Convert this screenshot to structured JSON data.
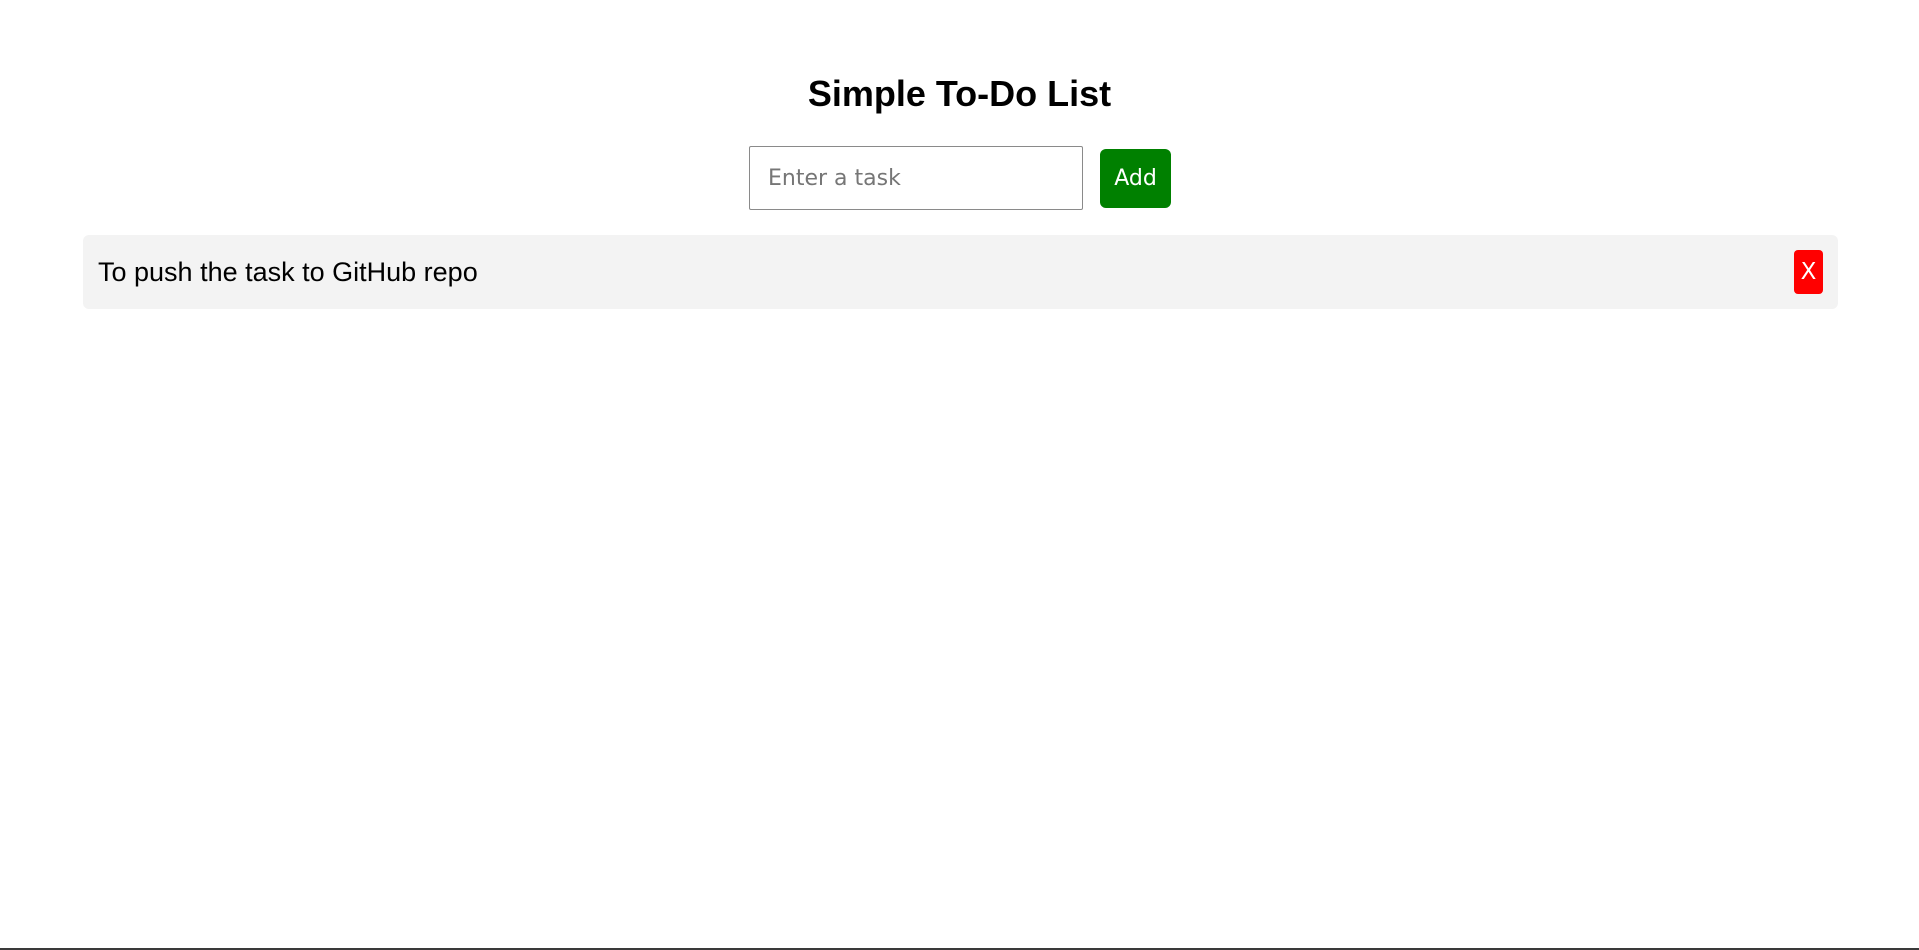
{
  "app": {
    "title": "Simple To-Do List"
  },
  "form": {
    "task_input": {
      "value": "",
      "placeholder": "Enter a task"
    },
    "add_label": "Add"
  },
  "tasks": [
    {
      "text": "To push the task to GitHub repo",
      "delete_label": "X"
    }
  ],
  "colors": {
    "add_button": "#008000",
    "delete_button": "#ff0000",
    "task_background": "#f3f3f3"
  }
}
